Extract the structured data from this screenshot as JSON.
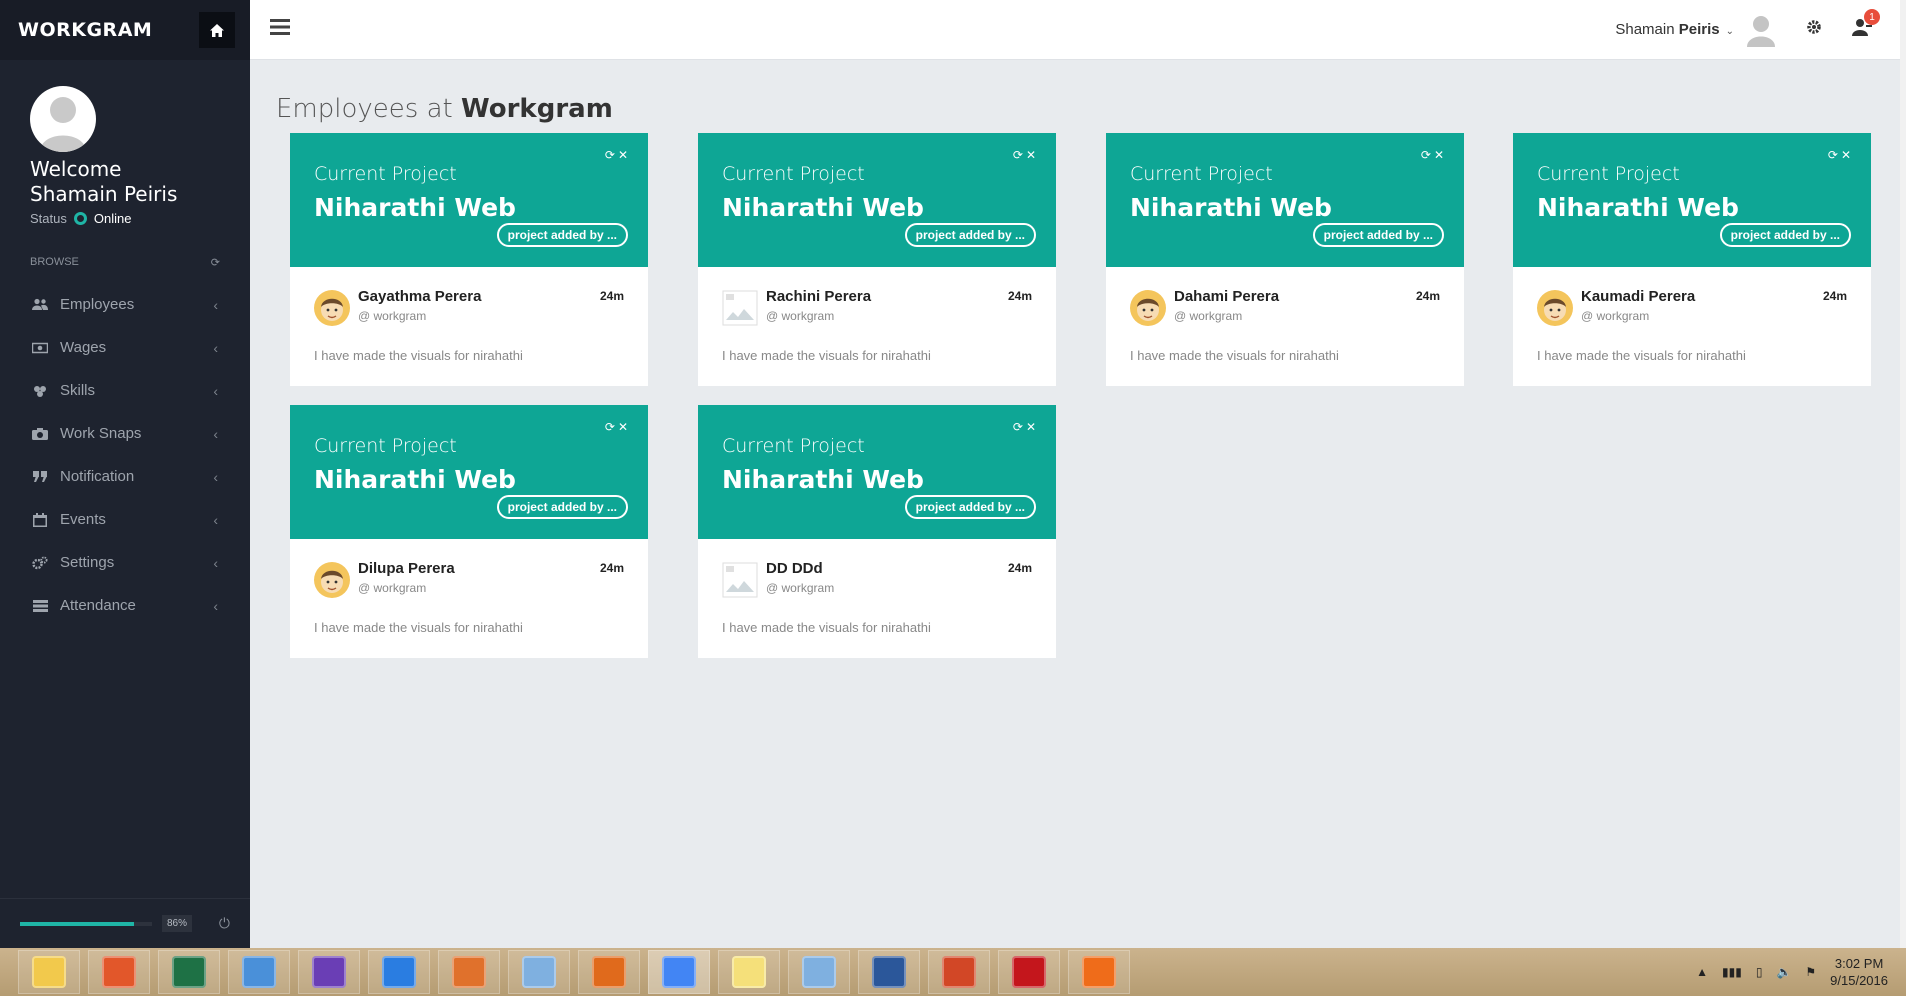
{
  "sidebar": {
    "brand": "WORKGRAM",
    "welcome_line1": "Welcome",
    "welcome_line2": "Shamain Peiris",
    "status_label": "Status",
    "status_value": "Online",
    "browse_label": "BROWSE",
    "items": [
      {
        "label": "Employees",
        "icon": "users-icon"
      },
      {
        "label": "Wages",
        "icon": "money-icon"
      },
      {
        "label": "Skills",
        "icon": "skills-icon"
      },
      {
        "label": "Work Snaps",
        "icon": "camera-icon"
      },
      {
        "label": "Notification",
        "icon": "quote-icon"
      },
      {
        "label": "Events",
        "icon": "calendar-icon"
      },
      {
        "label": "Settings",
        "icon": "cogs-icon"
      },
      {
        "label": "Attendance",
        "icon": "list-icon"
      }
    ],
    "progress_pct": 86,
    "progress_label": "86%"
  },
  "topbar": {
    "user_first": "Shamain",
    "user_last": "Peiris",
    "notification_count": "1"
  },
  "page": {
    "title_prefix": "Employees at",
    "title_brand": "Workgram"
  },
  "cards": [
    {
      "header_small": "Current Project",
      "header_big": "Niharathi Web",
      "pill": "project added by ...",
      "name": "Gayathma Perera",
      "handle": "@ workgram",
      "time": "24m",
      "text": "I have made the visuals for nirahathi",
      "avatar": "face"
    },
    {
      "header_small": "Current Project",
      "header_big": "Niharathi Web",
      "pill": "project added by ...",
      "name": "Rachini Perera",
      "handle": "@ workgram",
      "time": "24m",
      "text": "I have made the visuals for nirahathi",
      "avatar": "broken"
    },
    {
      "header_small": "Current Project",
      "header_big": "Niharathi Web",
      "pill": "project added by ...",
      "name": "Dahami Perera",
      "handle": "@ workgram",
      "time": "24m",
      "text": "I have made the visuals for nirahathi",
      "avatar": "face"
    },
    {
      "header_small": "Current Project",
      "header_big": "Niharathi Web",
      "pill": "project added by ...",
      "name": "Kaumadi Perera",
      "handle": "@ workgram",
      "time": "24m",
      "text": "I have made the visuals for nirahathi",
      "avatar": "face"
    },
    {
      "header_small": "Current Project",
      "header_big": "Niharathi Web",
      "pill": "project added by ...",
      "name": "Dilupa Perera",
      "handle": "@ workgram",
      "time": "24m",
      "text": "I have made the visuals for nirahathi",
      "avatar": "face"
    },
    {
      "header_small": "Current Project",
      "header_big": "Niharathi Web",
      "pill": "project added by ...",
      "name": "DD DDd",
      "handle": "@ workgram",
      "time": "24m",
      "text": "I have made the visuals for nirahathi",
      "avatar": "broken"
    }
  ],
  "taskbar": {
    "apps": [
      "file-explorer-icon",
      "firefox-dev-icon",
      "excel-icon",
      "notepad-icon",
      "visual-studio-icon",
      "internet-explorer-icon",
      "paint-icon",
      "virtualbox-icon",
      "firefox-icon",
      "chrome-icon",
      "sticky-notes-icon",
      "virtualbox-2-icon",
      "word-icon",
      "powerpoint-icon",
      "acrobat-icon",
      "xampp-icon"
    ],
    "active_app": "chrome-icon",
    "time": "3:02 PM",
    "date": "9/15/2016"
  },
  "colors": {
    "accent": "#0ea695",
    "sidebar_bg": "#1e232f",
    "page_bg": "#e8ebee",
    "badge": "#e84e3c"
  }
}
